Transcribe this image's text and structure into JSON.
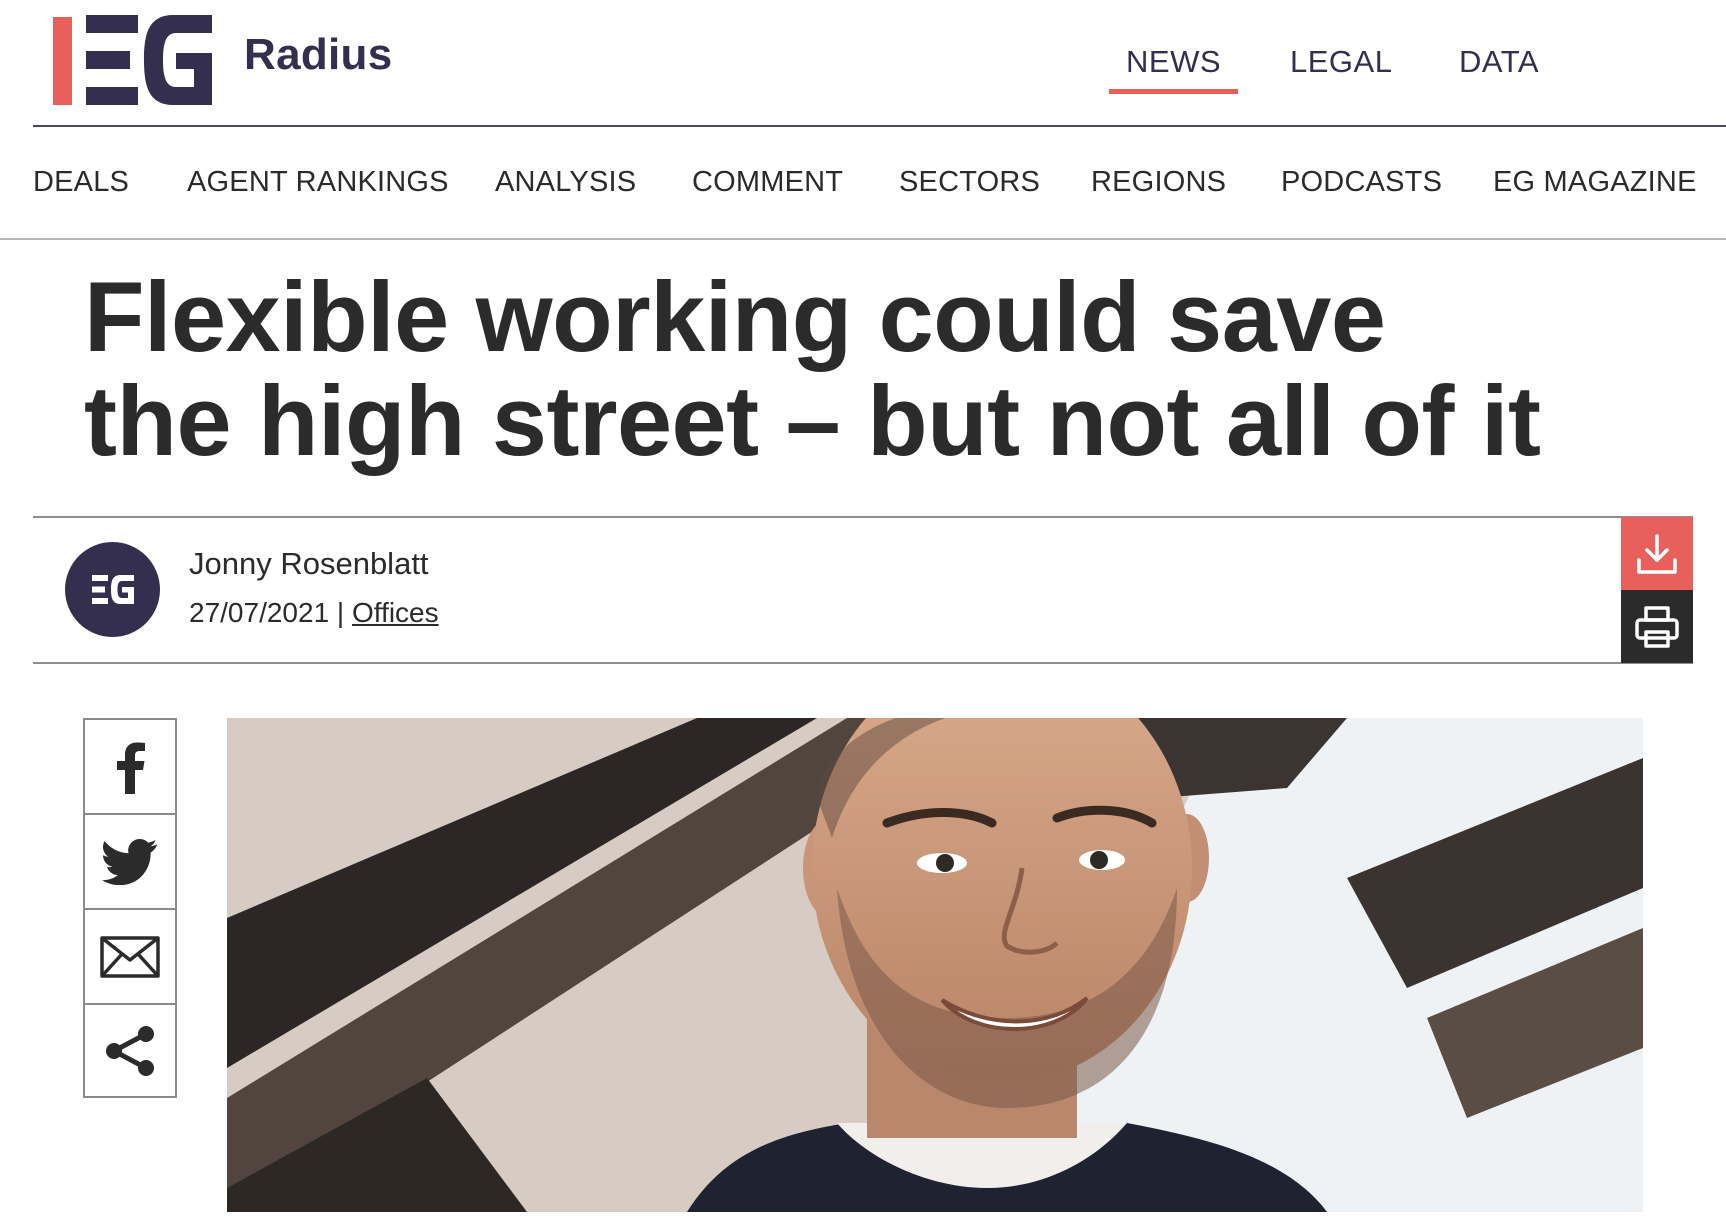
{
  "header": {
    "logo_alt": "EG",
    "brand": "Radius",
    "top_nav": [
      {
        "label": "NEWS",
        "active": true
      },
      {
        "label": "LEGAL",
        "active": false
      },
      {
        "label": "DATA",
        "active": false
      }
    ]
  },
  "section_nav": [
    "DEALS",
    "AGENT RANKINGS",
    "ANALYSIS",
    "COMMENT",
    "SECTORS",
    "REGIONS",
    "PODCASTS",
    "EG MAGAZINE"
  ],
  "article": {
    "headline_line1": "Flexible working could save",
    "headline_line2": "the high street – but not all of it",
    "author": "Jonny Rosenblatt",
    "date": "27/07/2021",
    "separator": "|",
    "category": "Offices"
  },
  "share": [
    "facebook-icon",
    "twitter-icon",
    "email-icon",
    "share-icon"
  ],
  "actions": [
    "download-icon",
    "print-icon"
  ],
  "colors": {
    "accent": "#e8605c",
    "brand_navy": "#342f4e",
    "text": "#2b2b2b"
  }
}
